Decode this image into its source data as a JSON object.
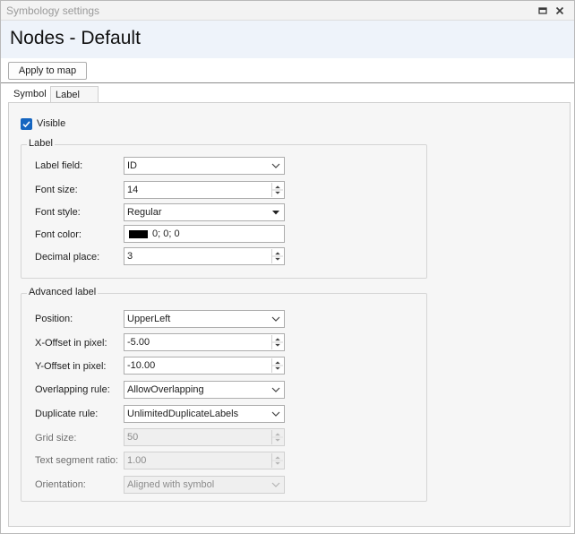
{
  "window": {
    "title": "Symbology settings",
    "float_icon": "float-window-icon",
    "close_icon": "close-icon"
  },
  "header": {
    "title": "Nodes - Default"
  },
  "toolbar": {
    "apply_label": "Apply to map"
  },
  "tabs": [
    {
      "label": "Symbol",
      "selected": false
    },
    {
      "label": "Label",
      "selected": true
    }
  ],
  "visible": {
    "label": "Visible",
    "checked": true
  },
  "label_group": {
    "title": "Label",
    "rows": [
      {
        "label": "Label field:",
        "value": "ID",
        "control": "dropdown"
      },
      {
        "label": "Font size:",
        "value": "14",
        "control": "spinner"
      },
      {
        "label": "Font style:",
        "value": "Regular",
        "control": "combo"
      },
      {
        "label": "Font color:",
        "value": "0; 0; 0",
        "control": "color",
        "color": "#000000"
      },
      {
        "label": "Decimal place:",
        "value": "3",
        "control": "spinner"
      }
    ]
  },
  "advanced_group": {
    "title": "Advanced label",
    "rows": [
      {
        "label": "Position:",
        "value": "UpperLeft",
        "control": "dropdown"
      },
      {
        "label": "X-Offset in pixel:",
        "value": "-5.00",
        "control": "spinner"
      },
      {
        "label": "Y-Offset in pixel:",
        "value": "-10.00",
        "control": "spinner"
      },
      {
        "label": "Overlapping rule:",
        "value": "AllowOverlapping",
        "control": "dropdown"
      },
      {
        "label": "Duplicate rule:",
        "value": "UnlimitedDuplicateLabels",
        "control": "dropdown"
      },
      {
        "label": "Grid size:",
        "value": "50",
        "control": "spinner",
        "disabled": true
      },
      {
        "label": "Text segment ratio:",
        "value": "1.00",
        "control": "spinner",
        "disabled": true
      },
      {
        "label": "Orientation:",
        "value": "Aligned with symbol",
        "control": "dropdown",
        "disabled": true
      }
    ]
  },
  "colors": {
    "accent": "#1565c0",
    "header_bg": "#eef3fa",
    "panel_bg": "#f6f6f6"
  }
}
